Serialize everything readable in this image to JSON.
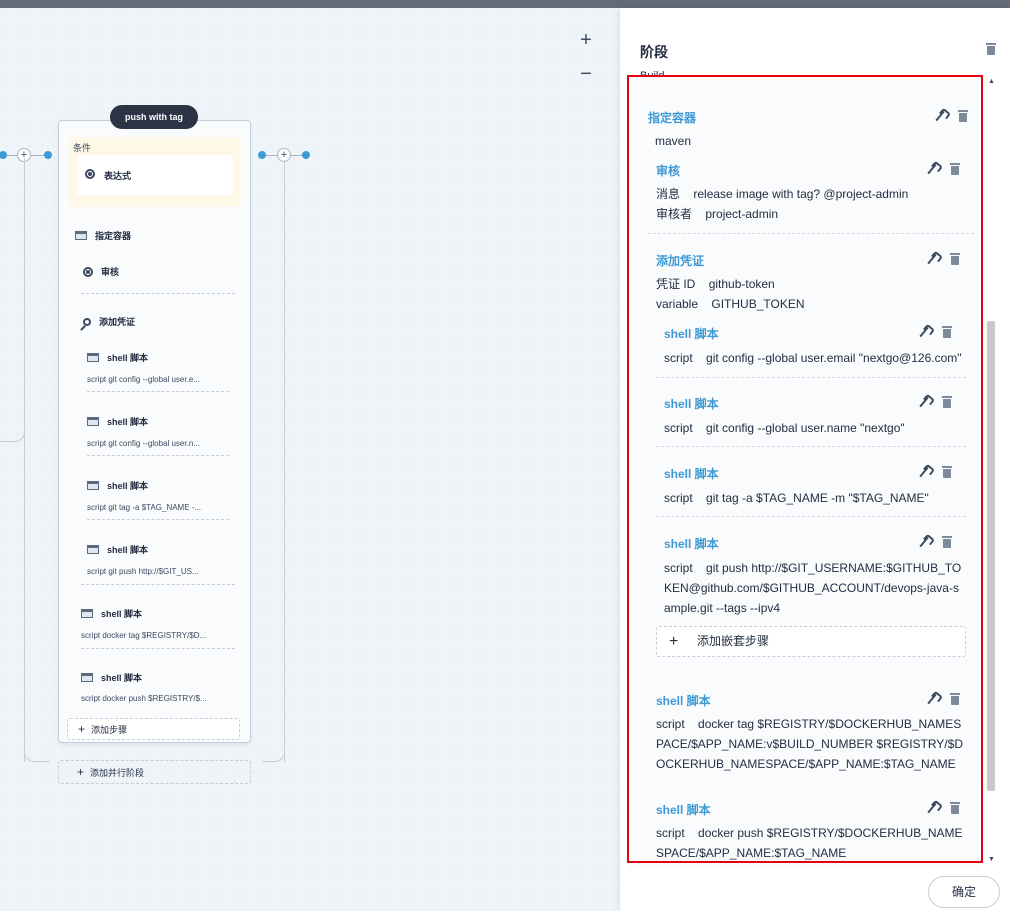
{
  "canvas": {
    "zoom_in": "+",
    "zoom_out": "−",
    "stage": {
      "name": "push with tag",
      "condition_title": "条件",
      "condition_item": "表达式",
      "steps": [
        {
          "label": "指定容器"
        },
        {
          "label": "审核"
        },
        {
          "label": "添加凭证"
        },
        {
          "label": "shell 脚本",
          "sub": "script   git config --global user.e..."
        },
        {
          "label": "shell 脚本",
          "sub": "script   git config --global user.n..."
        },
        {
          "label": "shell 脚本",
          "sub": "script   git tag -a $TAG_NAME -..."
        },
        {
          "label": "shell 脚本",
          "sub": "script   git push http://$GIT_US..."
        },
        {
          "label": "shell 脚本",
          "sub": "script   docker tag $REGISTRY/$D..."
        },
        {
          "label": "shell 脚本",
          "sub": "script   docker push $REGISTRY/$..."
        }
      ],
      "add_step": "添加步骤",
      "add_parallel": "添加并行阶段"
    }
  },
  "panel": {
    "title": "阶段",
    "cut_title": "Build",
    "container": {
      "title": "指定容器",
      "value": "maven"
    },
    "review": {
      "title": "审核",
      "msg_key": "消息",
      "msg_val": "release image with tag? @project-admin",
      "reviewer_key": "审核者",
      "reviewer_val": "project-admin"
    },
    "credential": {
      "title": "添加凭证",
      "id_key": "凭证 ID",
      "id_val": "github-token",
      "var_key": "variable",
      "var_val": "GITHUB_TOKEN"
    },
    "nested_steps": [
      {
        "title": "shell 脚本",
        "key": "script",
        "val": "git config --global user.email \"nextgo@126.com\""
      },
      {
        "title": "shell 脚本",
        "key": "script",
        "val": "git config --global user.name \"nextgo\""
      },
      {
        "title": "shell 脚本",
        "key": "script",
        "val": "git tag -a $TAG_NAME -m \"$TAG_NAME\""
      },
      {
        "title": "shell 脚本",
        "key": "script",
        "val": "git push http://$GIT_USERNAME:$GITHUB_TOKEN@github.com/$GITHUB_ACCOUNT/devops-java-sample.git --tags --ipv4"
      }
    ],
    "add_nested": "添加嵌套步骤",
    "outer_steps": [
      {
        "title": "shell 脚本",
        "key": "script",
        "val": "docker tag $REGISTRY/$DOCKERHUB_NAMESPACE/$APP_NAME:v$BUILD_NUMBER $REGISTRY/$DOCKERHUB_NAMESPACE/$APP_NAME:$TAG_NAME"
      },
      {
        "title": "shell 脚本",
        "key": "script",
        "val": "docker push $REGISTRY/$DOCKERHUB_NAMESPACE/$APP_NAME:$TAG_NAME"
      }
    ],
    "confirm": "确定"
  },
  "colors": {
    "accent": "#3d9ad6",
    "highlight": "#e60012",
    "dark": "#242e42"
  }
}
